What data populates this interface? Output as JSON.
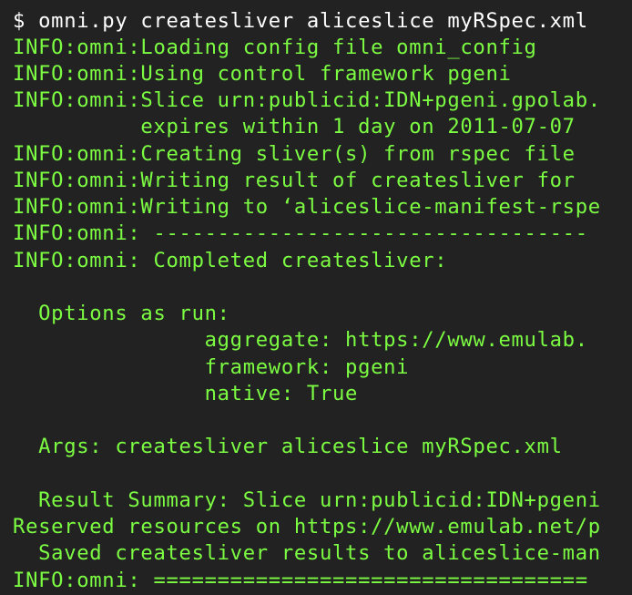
{
  "terminal": {
    "lines": [
      " $ omni.py createsliver aliceslice myRSpec.xml",
      " INFO:omni:Loading config file omni_config",
      " INFO:omni:Using control framework pgeni",
      " INFO:omni:Slice urn:publicid:IDN+pgeni.gpolab.",
      "           expires within 1 day on 2011-07-07",
      " INFO:omni:Creating sliver(s) from rspec file",
      " INFO:omni:Writing result of createsliver for",
      " INFO:omni:Writing to ‘aliceslice-manifest-rspe",
      " INFO:omni: ----------------------------------",
      " INFO:omni: Completed createsliver:",
      "",
      "   Options as run:",
      "                aggregate: https://www.emulab.",
      "                framework: pgeni",
      "                native: True",
      "",
      "   Args: createsliver aliceslice myRSpec.xml",
      "",
      "   Result Summary: Slice urn:publicid:IDN+pgeni",
      " Reserved resources on https://www.emulab.net/p",
      "   Saved createsliver results to aliceslice-man",
      " INFO:omni: =================================="
    ]
  },
  "colors": {
    "background": "#222222",
    "text": "#7CFC42",
    "prompt": "#ffffff"
  }
}
